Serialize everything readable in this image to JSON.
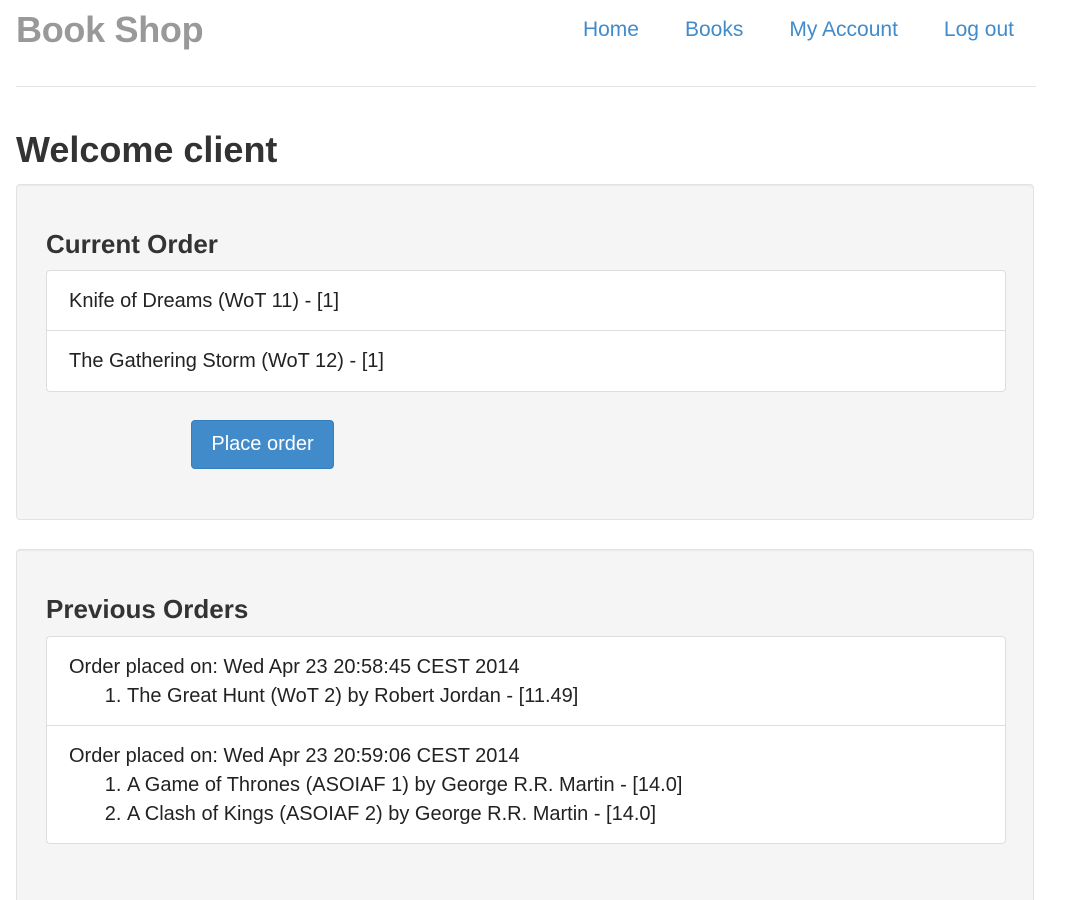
{
  "header": {
    "brand": "Book Shop",
    "nav": [
      {
        "label": "Home"
      },
      {
        "label": "Books"
      },
      {
        "label": "My Account"
      },
      {
        "label": "Log out"
      }
    ]
  },
  "welcome": "Welcome client",
  "current_order": {
    "title": "Current Order",
    "items": [
      {
        "text": "Knife of Dreams (WoT 11) - [1]"
      },
      {
        "text": "The Gathering Storm (WoT 12) - [1]"
      }
    ],
    "button_label": "Place order"
  },
  "previous_orders": {
    "title": "Previous Orders",
    "orders": [
      {
        "placed": "Order placed on: Wed Apr 23 20:58:45 CEST 2014",
        "items": [
          {
            "text": "The Great Hunt (WoT 2) by Robert Jordan - [11.49]"
          }
        ]
      },
      {
        "placed": "Order placed on: Wed Apr 23 20:59:06 CEST 2014",
        "items": [
          {
            "text": "A Game of Thrones (ASOIAF 1) by George R.R. Martin - [14.0]"
          },
          {
            "text": "A Clash of Kings (ASOIAF 2) by George R.R. Martin - [14.0]"
          }
        ]
      }
    ]
  },
  "colors": {
    "link": "#428bca",
    "brand": "#999999",
    "well_bg": "#f5f5f5",
    "button_bg": "#428bca"
  }
}
